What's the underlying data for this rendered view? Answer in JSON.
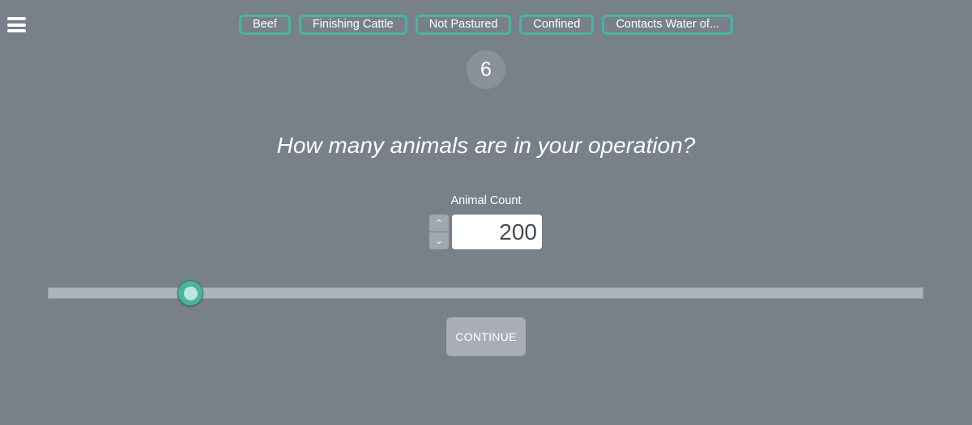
{
  "nav": {
    "menu_icon": "hamburger-menu-icon"
  },
  "tags": [
    {
      "label": "Beef"
    },
    {
      "label": "Finishing Cattle"
    },
    {
      "label": "Not Pastured"
    },
    {
      "label": "Confined"
    },
    {
      "label": "Contacts Water of..."
    }
  ],
  "step": {
    "number": "6"
  },
  "question": {
    "text": "How many animals are in your operation?"
  },
  "animal_count": {
    "label": "Animal Count",
    "value": "200",
    "increment_icon": "chevron-up-icon",
    "decrement_icon": "chevron-down-icon",
    "increment_glyph": "⌃",
    "decrement_glyph": "⌄"
  },
  "slider": {
    "fraction": 0.163
  },
  "colors": {
    "accent": "#4ab4a0",
    "background": "#78808a"
  },
  "continue_button": {
    "label": "CONTINUE"
  }
}
